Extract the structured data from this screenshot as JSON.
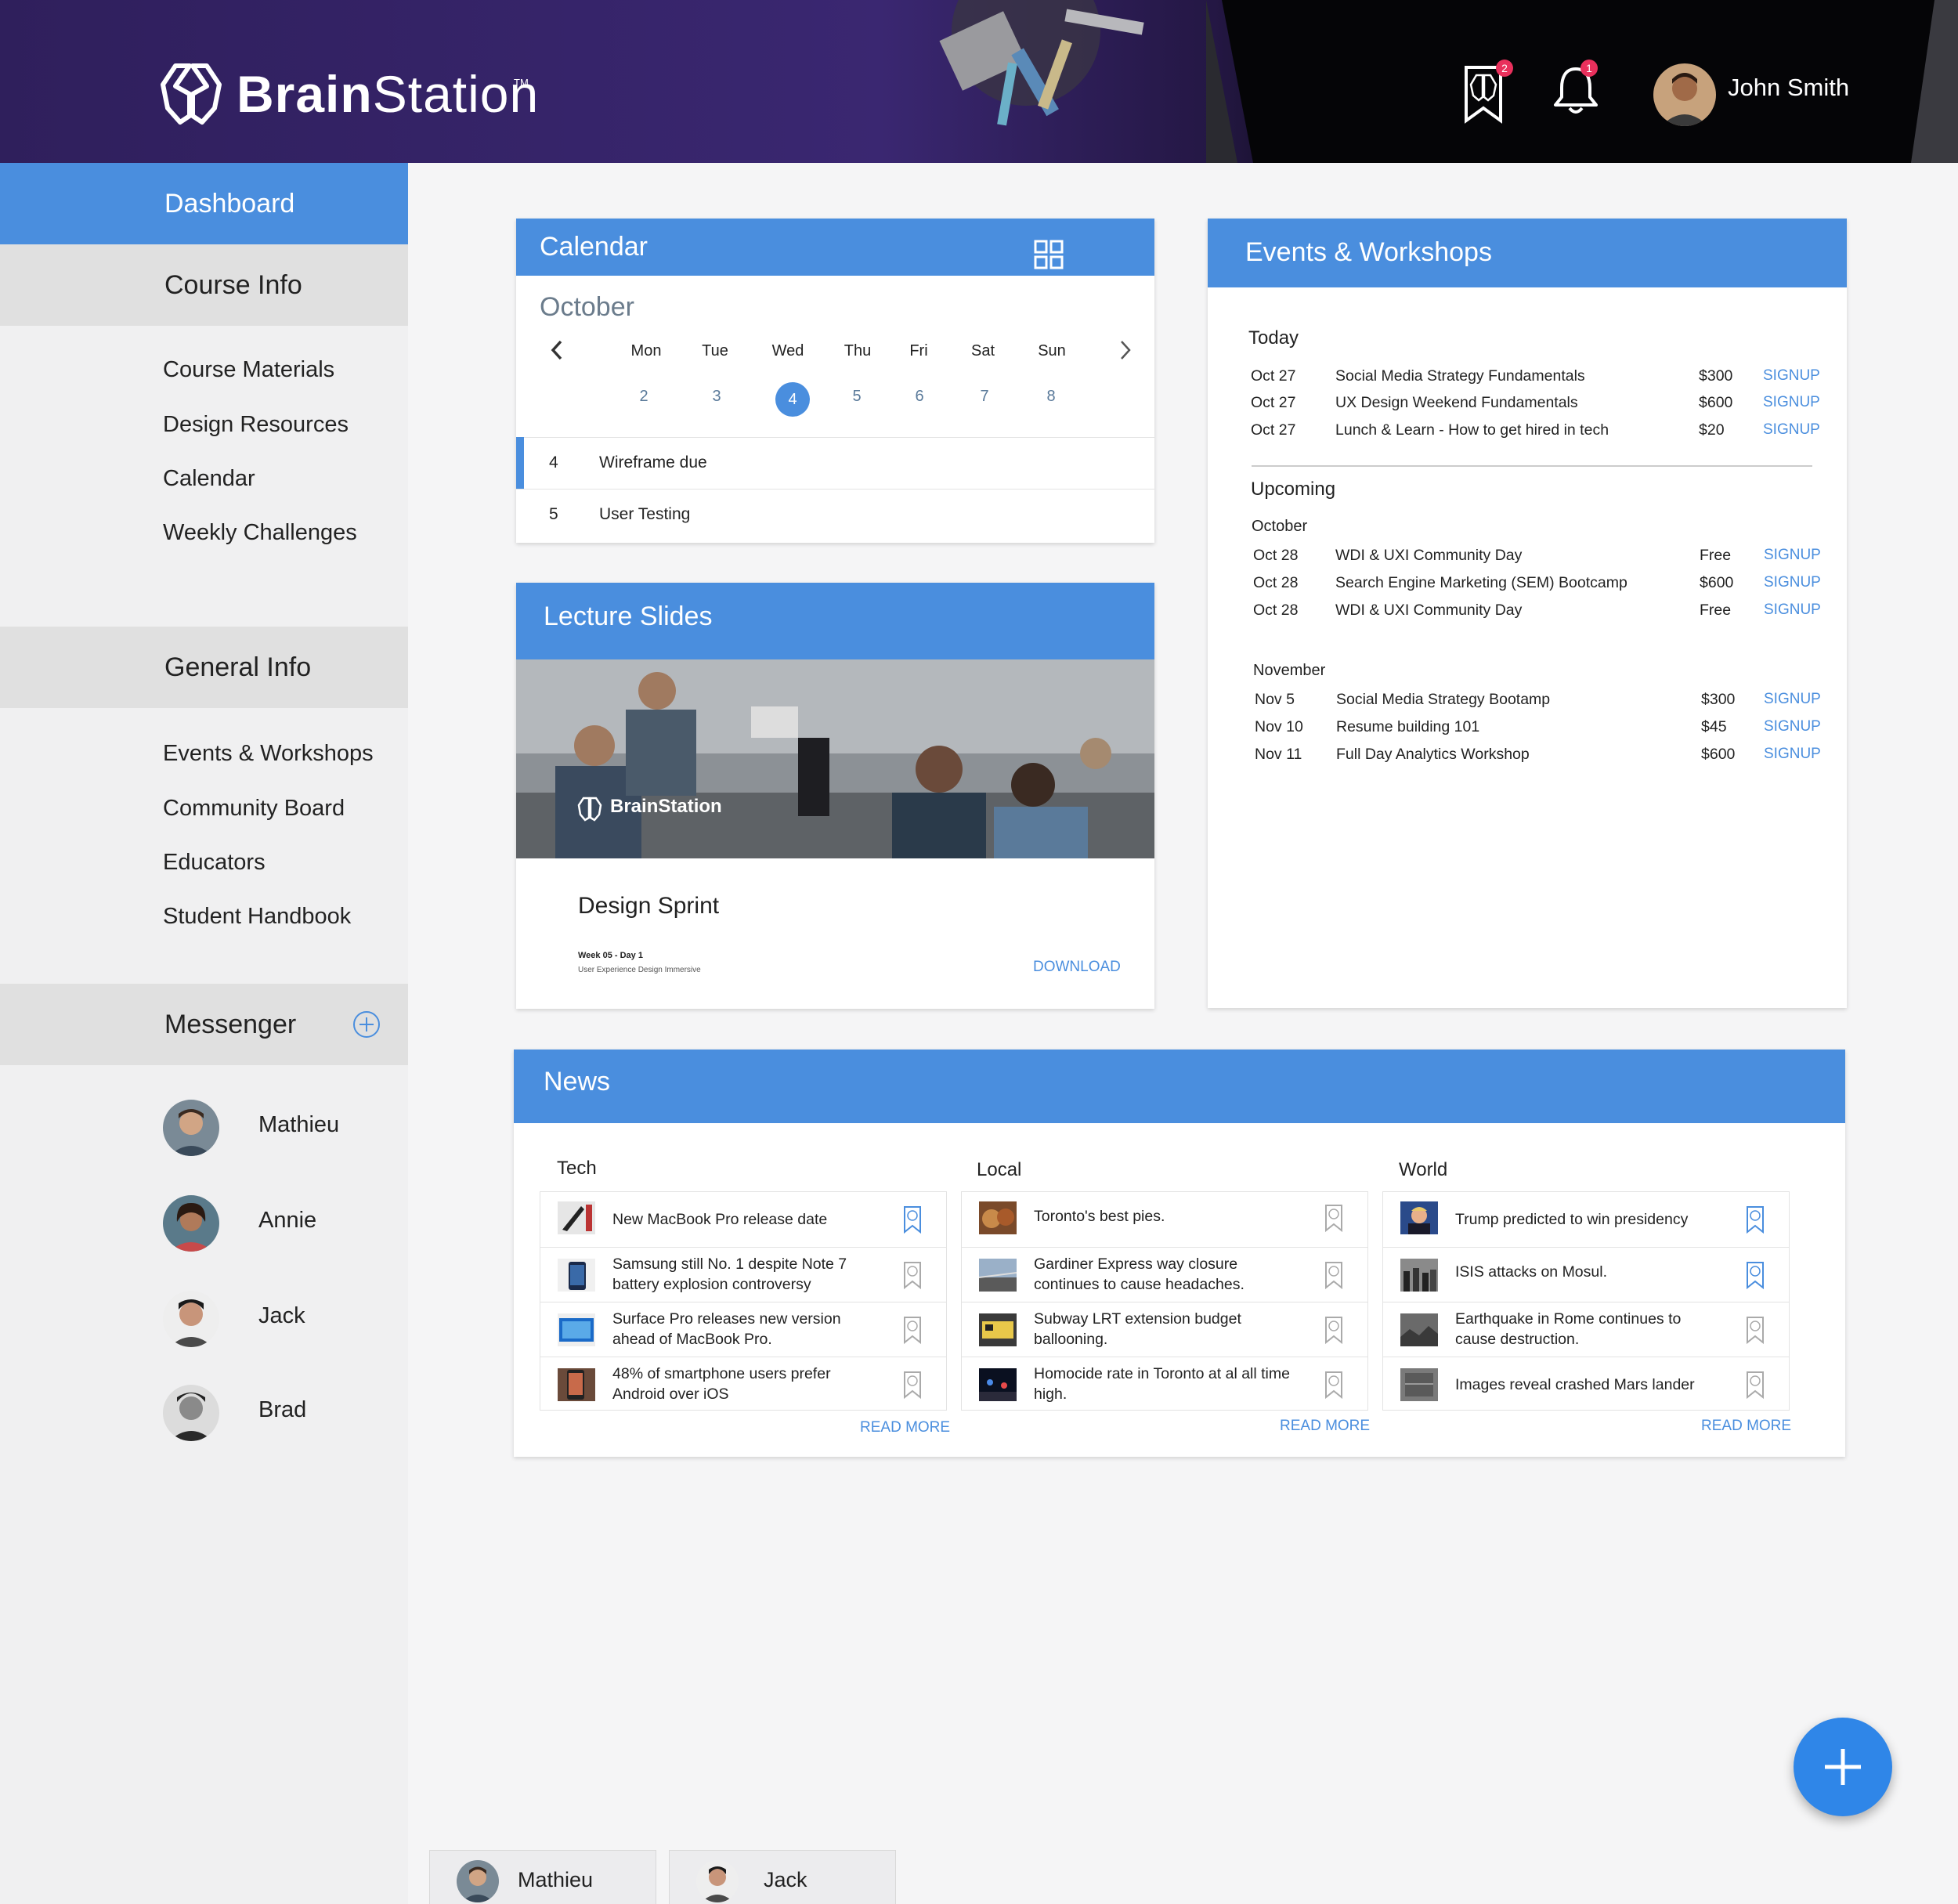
{
  "brand": {
    "name_bold": "Brain",
    "name_rest": "Station",
    "tm": "TM"
  },
  "header": {
    "bookmarks_badge": "2",
    "notifications_badge": "1",
    "user_name": "John Smith"
  },
  "sidebar": {
    "dashboard": "Dashboard",
    "course_info": "Course Info",
    "course_links": [
      "Course Materials",
      "Design Resources",
      "Calendar",
      "Weekly Challenges"
    ],
    "general_info": "General Info",
    "general_links": [
      "Events & Workshops",
      "Community Board",
      "Educators",
      "Student Handbook"
    ],
    "messenger": "Messenger",
    "contacts": [
      "Mathieu",
      "Annie",
      "Jack",
      "Brad"
    ]
  },
  "calendar": {
    "title": "Calendar",
    "month": "October",
    "days": [
      "Mon",
      "Tue",
      "Wed",
      "Thu",
      "Fri",
      "Sat",
      "Sun"
    ],
    "dates": [
      "2",
      "3",
      "4",
      "5",
      "6",
      "7",
      "8"
    ],
    "selected": "4",
    "events": [
      {
        "day": "4",
        "title": "Wireframe due"
      },
      {
        "day": "5",
        "title": "User Testing"
      }
    ]
  },
  "lecture": {
    "title": "Lecture Slides",
    "slide_title": "Design Sprint",
    "week": "Week 05 - Day 1",
    "course": "User Experience Design Immersive",
    "download": "DOWNLOAD",
    "image_logo": "BrainStation"
  },
  "events": {
    "title": "Events & Workshops",
    "today_label": "Today",
    "today": [
      {
        "date": "Oct 27",
        "name": "Social Media Strategy Fundamentals",
        "price": "$300",
        "action": "SIGNUP"
      },
      {
        "date": "Oct 27",
        "name": "UX Design Weekend Fundamentals",
        "price": "$600",
        "action": "SIGNUP"
      },
      {
        "date": "Oct 27",
        "name": "Lunch & Learn - How to get hired in tech",
        "price": "$20",
        "action": "SIGNUP"
      }
    ],
    "upcoming_label": "Upcoming",
    "october_label": "October",
    "october": [
      {
        "date": "Oct 28",
        "name": "WDI & UXI Community Day",
        "price": "Free",
        "action": "SIGNUP"
      },
      {
        "date": "Oct 28",
        "name": "Search Engine Marketing (SEM) Bootcamp",
        "price": "$600",
        "action": "SIGNUP"
      },
      {
        "date": "Oct 28",
        "name": "WDI & UXI Community Day",
        "price": "Free",
        "action": "SIGNUP"
      }
    ],
    "november_label": "November",
    "november": [
      {
        "date": "Nov 5",
        "name": "Social Media Strategy Bootamp",
        "price": "$300",
        "action": "SIGNUP"
      },
      {
        "date": "Nov 10",
        "name": "Resume building 101",
        "price": "$45",
        "action": "SIGNUP"
      },
      {
        "date": "Nov 11",
        "name": "Full Day Analytics Workshop",
        "price": "$600",
        "action": "SIGNUP"
      }
    ]
  },
  "news": {
    "title": "News",
    "read_more": "READ MORE",
    "columns": [
      {
        "heading": "Tech",
        "items": [
          "New MacBook Pro release date",
          "Samsung still No. 1 despite Note 7 battery explosion controversy",
          "Surface Pro releases new version ahead of MacBook Pro.",
          "48% of smartphone users prefer Android over iOS"
        ]
      },
      {
        "heading": "Local",
        "items": [
          "Toronto's best pies.",
          "Gardiner Express way closure continues to cause headaches.",
          "Subway LRT extension budget ballooning.",
          "Homocide rate in Toronto at al all time high."
        ]
      },
      {
        "heading": "World",
        "items": [
          "Trump predicted to win presidency",
          "ISIS attacks on Mosul.",
          "Earthquake in Rome continues to cause destruction.",
          "Images reveal crashed Mars lander"
        ]
      }
    ]
  },
  "chat_tabs": [
    "Mathieu",
    "Jack"
  ],
  "colors": {
    "accent": "#4a8ede",
    "header": "#2f1f5c",
    "badge": "#e9305c",
    "fab": "#2f86e8"
  }
}
